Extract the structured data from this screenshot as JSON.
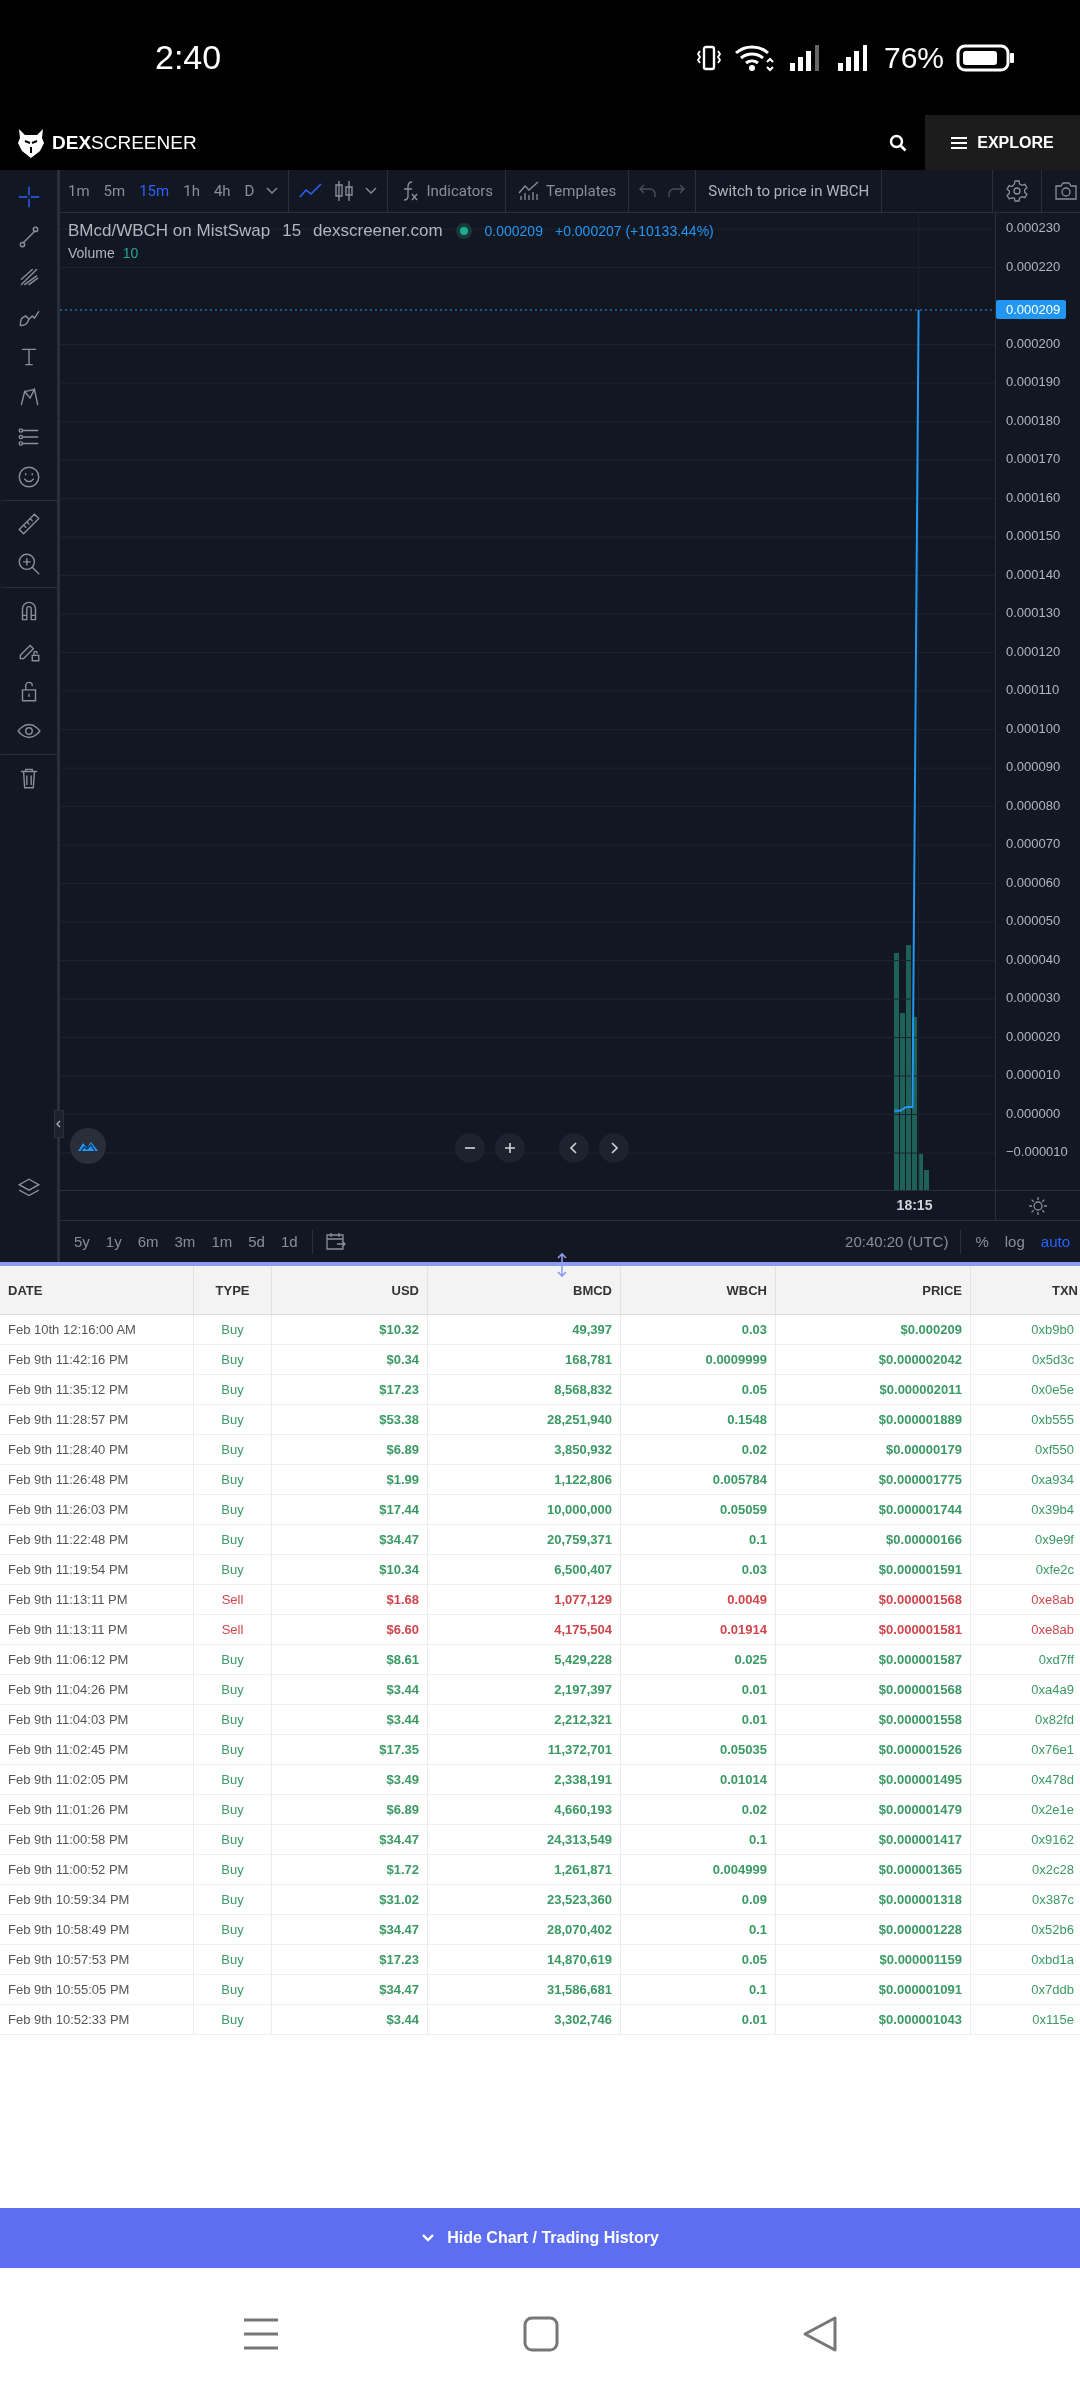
{
  "status_bar": {
    "time": "2:40",
    "battery": "76%"
  },
  "header": {
    "logo": "**DEX**SCREENER",
    "explore": "EXPLORE"
  },
  "toolbar": {
    "intervals": [
      {
        "label": "1m",
        "selected": false
      },
      {
        "label": "5m",
        "selected": false
      },
      {
        "label": "15m",
        "selected": true
      },
      {
        "label": "1h",
        "selected": false
      },
      {
        "label": "4h",
        "selected": false
      },
      {
        "label": "D",
        "selected": false
      }
    ],
    "chart_styles": [
      {
        "kind": "line",
        "selected": true
      },
      {
        "kind": "candles",
        "selected": false
      }
    ],
    "indicators": "Indicators",
    "templates": "Templates",
    "switch": "Switch to price in WBCH"
  },
  "drawing_tools": [
    {
      "tools": [
        {
          "kind": "crosshair",
          "selected": true
        },
        {
          "kind": "line",
          "selected": false
        },
        {
          "kind": "fork",
          "selected": false
        },
        {
          "kind": "brush",
          "selected": false
        },
        {
          "kind": "text",
          "selected": false
        },
        {
          "kind": "pattern",
          "selected": false
        },
        {
          "kind": "sliders",
          "selected": false
        },
        {
          "kind": "smiley",
          "selected": false
        }
      ]
    },
    {
      "tools": [
        {
          "kind": "ruler",
          "selected": false
        },
        {
          "kind": "zoom-in",
          "selected": false
        }
      ]
    },
    {
      "tools": [
        {
          "kind": "magnet",
          "selected": false
        },
        {
          "kind": "pencil-lock",
          "selected": false
        },
        {
          "kind": "lock",
          "selected": false
        },
        {
          "kind": "eye",
          "selected": false
        }
      ]
    },
    {
      "tools": [
        {
          "kind": "trash",
          "selected": false
        }
      ]
    }
  ],
  "chart": {
    "legend": {
      "symbol": "BMcd/WBCH on MistSwap",
      "interval": "15",
      "source": "dexscreener.com",
      "price": "0.000209",
      "change": "+0.000207 (+10133.44%)",
      "volume_label": "Volume",
      "volume": "10"
    },
    "last_price_label": "0.000209",
    "time_axis_label": "18:15",
    "chart_data": {
      "type": "line",
      "ylim": [
        -1.96e-05,
        0.0002342
      ],
      "grid": true,
      "ref_lines": [
        {
          "axis": "y",
          "value": 0.000209,
          "color": "#2196f3"
        }
      ],
      "categories": [
        null,
        null,
        null,
        null,
        null,
        null,
        null,
        null,
        null,
        null,
        null,
        null,
        null,
        null,
        null,
        null,
        null,
        null,
        null,
        null,
        null,
        null,
        null,
        null,
        null,
        null,
        null,
        null,
        null,
        null,
        null,
        null,
        null,
        null,
        null,
        null,
        null,
        null,
        null,
        null,
        null,
        null,
        null,
        null,
        null,
        null,
        null,
        null,
        null,
        null,
        null,
        null,
        null,
        null,
        null,
        null,
        null,
        null,
        null,
        null,
        null,
        null,
        null,
        null,
        null,
        null,
        null,
        null,
        null,
        null,
        null,
        null,
        null,
        null,
        null,
        null,
        null,
        null,
        null,
        null,
        null,
        null,
        null,
        null,
        null,
        null,
        null,
        null,
        null,
        null,
        null,
        null,
        null,
        null,
        null,
        null,
        null,
        null,
        null,
        null,
        null,
        null,
        null,
        null,
        null,
        null,
        null,
        null,
        null,
        null,
        null,
        null,
        null,
        null,
        null,
        null,
        null,
        null,
        null,
        null,
        null,
        null,
        null,
        null,
        null,
        null,
        null,
        null,
        null,
        null,
        null,
        null,
        null,
        null,
        null,
        null,
        null,
        null,
        null,
        null,
        null,
        null,
        null,
        null,
        null,
        null,
        null,
        null,
        null,
        null,
        null,
        null,
        null
      ],
      "series": [
        {
          "color": "#2196f3",
          "values": [
            null,
            null,
            null,
            null,
            null,
            null,
            null,
            null,
            null,
            null,
            null,
            null,
            null,
            null,
            null,
            null,
            null,
            null,
            null,
            null,
            null,
            null,
            null,
            null,
            null,
            null,
            null,
            null,
            null,
            null,
            null,
            null,
            null,
            null,
            null,
            null,
            null,
            null,
            null,
            null,
            null,
            null,
            null,
            null,
            null,
            null,
            null,
            null,
            null,
            null,
            null,
            null,
            null,
            null,
            null,
            null,
            null,
            null,
            null,
            null,
            null,
            null,
            null,
            null,
            null,
            null,
            null,
            null,
            null,
            null,
            null,
            null,
            null,
            null,
            null,
            null,
            null,
            null,
            null,
            null,
            null,
            null,
            null,
            null,
            null,
            null,
            null,
            null,
            null,
            null,
            null,
            null,
            null,
            null,
            null,
            null,
            null,
            null,
            null,
            null,
            null,
            null,
            null,
            null,
            null,
            null,
            null,
            null,
            null,
            null,
            null,
            null,
            null,
            null,
            null,
            null,
            null,
            null,
            null,
            null,
            null,
            null,
            null,
            null,
            null,
            null,
            null,
            null,
            null,
            null,
            null,
            null,
            null,
            null,
            null,
            null,
            1e-06,
            1e-06,
            2e-06,
            2e-06,
            0.000209,
            null,
            null,
            null,
            null,
            null,
            null,
            null,
            null,
            null,
            null,
            null,
            null
          ]
        }
      ],
      "yticks": [
        {
          "value": 0.00023,
          "label": "0.000230"
        },
        {
          "value": 0.00022,
          "label": "0.000220"
        },
        {
          "value": 0.0002,
          "label": "0.000200"
        },
        {
          "value": 0.00019,
          "label": "0.000190"
        },
        {
          "value": 0.00018,
          "label": "0.000180"
        },
        {
          "value": 0.00017,
          "label": "0.000170"
        },
        {
          "value": 0.00016,
          "label": "0.000160"
        },
        {
          "value": 0.00015,
          "label": "0.000150"
        },
        {
          "value": 0.00014,
          "label": "0.000140"
        },
        {
          "value": 0.00013,
          "label": "0.000130"
        },
        {
          "value": 0.00012,
          "label": "0.000120"
        },
        {
          "value": 0.00011,
          "label": "0.000110"
        },
        {
          "value": 0.0001,
          "label": "0.000100"
        },
        {
          "value": 9e-05,
          "label": "0.000090"
        },
        {
          "value": 8e-05,
          "label": "0.000080"
        },
        {
          "value": 7e-05,
          "label": "0.000070"
        },
        {
          "value": 6e-05,
          "label": "0.000060"
        },
        {
          "value": 5e-05,
          "label": "0.000050"
        },
        {
          "value": 4e-05,
          "label": "0.000040"
        },
        {
          "value": 3e-05,
          "label": "0.000030"
        },
        {
          "value": 2e-05,
          "label": "0.000020"
        },
        {
          "value": 1e-05,
          "label": "0.000010"
        },
        {
          "value": 0,
          "label": "0.000000"
        },
        {
          "value": -1e-05,
          "label": "−0.000010"
        }
      ]
    }
  },
  "range_bar": {
    "ranges": [
      "5y",
      "1y",
      "6m",
      "3m",
      "1m",
      "5d",
      "1d"
    ],
    "clock": "20:40:20 (UTC)",
    "scale_options": [
      {
        "label": "%",
        "selected": false
      },
      {
        "label": "log",
        "selected": false
      },
      {
        "label": "auto",
        "selected": true
      }
    ]
  },
  "table": {
    "columns": [
      "DATE",
      "TYPE",
      "USD",
      "BMCD",
      "WBCH",
      "PRICE",
      "TXN"
    ],
    "rows": [
      {
        "kind": "buy",
        "date": "Feb 10th 12:16:00 AM",
        "type": "Buy",
        "usd": "$10.32",
        "bmcd": "49,397",
        "wbch": "0.03",
        "price": "$0.000209",
        "txn": "0xb9b0"
      },
      {
        "kind": "buy",
        "date": "Feb 9th 11:42:16 PM",
        "type": "Buy",
        "usd": "$0.34",
        "bmcd": "168,781",
        "wbch": "0.0009999",
        "price": "$0.000002042",
        "txn": "0x5d3c"
      },
      {
        "kind": "buy",
        "date": "Feb 9th 11:35:12 PM",
        "type": "Buy",
        "usd": "$17.23",
        "bmcd": "8,568,832",
        "wbch": "0.05",
        "price": "$0.000002011",
        "txn": "0x0e5e"
      },
      {
        "kind": "buy",
        "date": "Feb 9th 11:28:57 PM",
        "type": "Buy",
        "usd": "$53.38",
        "bmcd": "28,251,940",
        "wbch": "0.1548",
        "price": "$0.000001889",
        "txn": "0xb555"
      },
      {
        "kind": "buy",
        "date": "Feb 9th 11:28:40 PM",
        "type": "Buy",
        "usd": "$6.89",
        "bmcd": "3,850,932",
        "wbch": "0.02",
        "price": "$0.00000179",
        "txn": "0xf550"
      },
      {
        "kind": "buy",
        "date": "Feb 9th 11:26:48 PM",
        "type": "Buy",
        "usd": "$1.99",
        "bmcd": "1,122,806",
        "wbch": "0.005784",
        "price": "$0.000001775",
        "txn": "0xa934"
      },
      {
        "kind": "buy",
        "date": "Feb 9th 11:26:03 PM",
        "type": "Buy",
        "usd": "$17.44",
        "bmcd": "10,000,000",
        "wbch": "0.05059",
        "price": "$0.000001744",
        "txn": "0x39b4"
      },
      {
        "kind": "buy",
        "date": "Feb 9th 11:22:48 PM",
        "type": "Buy",
        "usd": "$34.47",
        "bmcd": "20,759,371",
        "wbch": "0.1",
        "price": "$0.00000166",
        "txn": "0x9e9f"
      },
      {
        "kind": "buy",
        "date": "Feb 9th 11:19:54 PM",
        "type": "Buy",
        "usd": "$10.34",
        "bmcd": "6,500,407",
        "wbch": "0.03",
        "price": "$0.000001591",
        "txn": "0xfe2c"
      },
      {
        "kind": "sell",
        "date": "Feb 9th 11:13:11 PM",
        "type": "Sell",
        "usd": "$1.68",
        "bmcd": "1,077,129",
        "wbch": "0.0049",
        "price": "$0.000001568",
        "txn": "0xe8ab"
      },
      {
        "kind": "sell",
        "date": "Feb 9th 11:13:11 PM",
        "type": "Sell",
        "usd": "$6.60",
        "bmcd": "4,175,504",
        "wbch": "0.01914",
        "price": "$0.000001581",
        "txn": "0xe8ab"
      },
      {
        "kind": "buy",
        "date": "Feb 9th 11:06:12 PM",
        "type": "Buy",
        "usd": "$8.61",
        "bmcd": "5,429,228",
        "wbch": "0.025",
        "price": "$0.000001587",
        "txn": "0xd7ff"
      },
      {
        "kind": "buy",
        "date": "Feb 9th 11:04:26 PM",
        "type": "Buy",
        "usd": "$3.44",
        "bmcd": "2,197,397",
        "wbch": "0.01",
        "price": "$0.000001568",
        "txn": "0xa4a9"
      },
      {
        "kind": "buy",
        "date": "Feb 9th 11:04:03 PM",
        "type": "Buy",
        "usd": "$3.44",
        "bmcd": "2,212,321",
        "wbch": "0.01",
        "price": "$0.000001558",
        "txn": "0x82fd"
      },
      {
        "kind": "buy",
        "date": "Feb 9th 11:02:45 PM",
        "type": "Buy",
        "usd": "$17.35",
        "bmcd": "11,372,701",
        "wbch": "0.05035",
        "price": "$0.000001526",
        "txn": "0x76e1"
      },
      {
        "kind": "buy",
        "date": "Feb 9th 11:02:05 PM",
        "type": "Buy",
        "usd": "$3.49",
        "bmcd": "2,338,191",
        "wbch": "0.01014",
        "price": "$0.000001495",
        "txn": "0x478d"
      },
      {
        "kind": "buy",
        "date": "Feb 9th 11:01:26 PM",
        "type": "Buy",
        "usd": "$6.89",
        "bmcd": "4,660,193",
        "wbch": "0.02",
        "price": "$0.000001479",
        "txn": "0x2e1e"
      },
      {
        "kind": "buy",
        "date": "Feb 9th 11:00:58 PM",
        "type": "Buy",
        "usd": "$34.47",
        "bmcd": "24,313,549",
        "wbch": "0.1",
        "price": "$0.000001417",
        "txn": "0x9162"
      },
      {
        "kind": "buy",
        "date": "Feb 9th 11:00:52 PM",
        "type": "Buy",
        "usd": "$1.72",
        "bmcd": "1,261,871",
        "wbch": "0.004999",
        "price": "$0.000001365",
        "txn": "0x2c28"
      },
      {
        "kind": "buy",
        "date": "Feb 9th 10:59:34 PM",
        "type": "Buy",
        "usd": "$31.02",
        "bmcd": "23,523,360",
        "wbch": "0.09",
        "price": "$0.000001318",
        "txn": "0x387c"
      },
      {
        "kind": "buy",
        "date": "Feb 9th 10:58:49 PM",
        "type": "Buy",
        "usd": "$34.47",
        "bmcd": "28,070,402",
        "wbch": "0.1",
        "price": "$0.000001228",
        "txn": "0x52b6"
      },
      {
        "kind": "buy",
        "date": "Feb 9th 10:57:53 PM",
        "type": "Buy",
        "usd": "$17.23",
        "bmcd": "14,870,619",
        "wbch": "0.05",
        "price": "$0.000001159",
        "txn": "0xbd1a"
      },
      {
        "kind": "buy",
        "date": "Feb 9th 10:55:05 PM",
        "type": "Buy",
        "usd": "$34.47",
        "bmcd": "31,586,681",
        "wbch": "0.1",
        "price": "$0.000001091",
        "txn": "0x7ddb"
      },
      {
        "kind": "buy",
        "date": "Feb 9th 10:52:33 PM",
        "type": "Buy",
        "usd": "$3.44",
        "bmcd": "3,302,746",
        "wbch": "0.01",
        "price": "$0.000001043",
        "txn": "0x115e"
      }
    ]
  },
  "footer_button": "Hide Chart / Trading History"
}
